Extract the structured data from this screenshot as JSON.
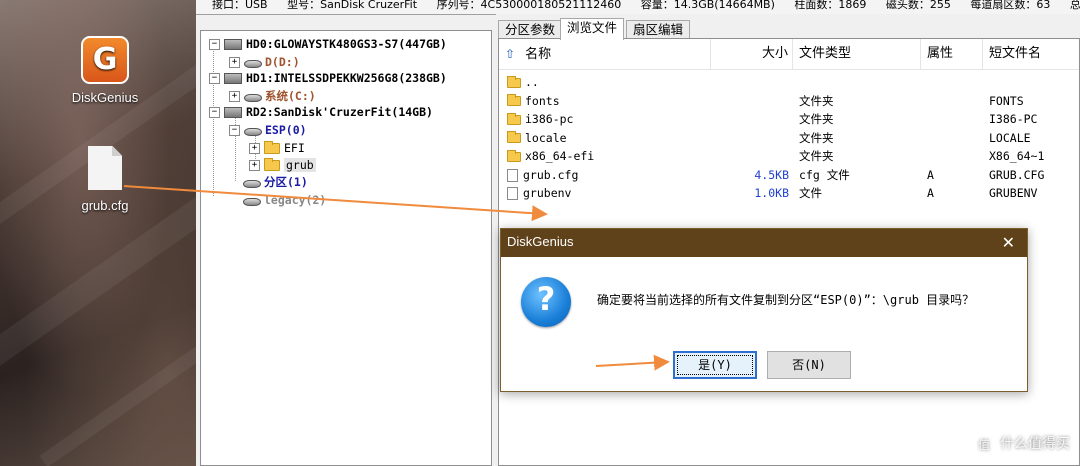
{
  "infobar": {
    "interface": "接口：USB",
    "model": "型号：SanDisk CruzerFit",
    "serial": "序列号：4C530000180521112460",
    "capacity": "容量：14.3GB(14664MB)",
    "cylinders": "柱面数：1869",
    "heads": "磁头数：255",
    "sectors": "每道扇区数：63",
    "total": "总扇区数："
  },
  "desktop": {
    "app_icon_label": "DiskGenius",
    "file_icon_label": "grub.cfg"
  },
  "tree": {
    "hd0": "HD0:GLOWAYSTK480GS3-S7(447GB)",
    "hd0_part": "D(D:)",
    "hd1": "HD1:INTELSSDPEKKW256G8(238GB)",
    "hd1_part": "系统(C:)",
    "rd2": "RD2:SanDisk'CruzerFit(14GB)",
    "esp": "ESP(0)",
    "efi": "EFI",
    "grub": "grub",
    "part1": "分区(1)",
    "legacy": "legacy(2)",
    "colors": {
      "hd0_part": "#a0522d",
      "esp": "#1a1aa6",
      "part1": "#1a1aa6"
    }
  },
  "tabs": [
    "分区参数",
    "浏览文件",
    "扇区编辑"
  ],
  "active_tab": 1,
  "filelist": {
    "columns": [
      "名称",
      "大小",
      "文件类型",
      "属性",
      "短文件名"
    ],
    "rows": [
      {
        "name": "..",
        "size": "",
        "type": "",
        "attr": "",
        "short": "",
        "icon": "folder-icon"
      },
      {
        "name": "fonts",
        "size": "",
        "type": "文件夹",
        "attr": "",
        "short": "FONTS",
        "icon": "folder-icon"
      },
      {
        "name": "i386-pc",
        "size": "",
        "type": "文件夹",
        "attr": "",
        "short": "I386-PC",
        "icon": "folder-icon"
      },
      {
        "name": "locale",
        "size": "",
        "type": "文件夹",
        "attr": "",
        "short": "LOCALE",
        "icon": "folder-icon"
      },
      {
        "name": "x86_64-efi",
        "size": "",
        "type": "文件夹",
        "attr": "",
        "short": "X86_64~1",
        "icon": "folder-icon"
      },
      {
        "name": "grub.cfg",
        "size": "4.5KB",
        "type": "cfg 文件",
        "attr": "A",
        "short": "GRUB.CFG",
        "icon": "document-icon"
      },
      {
        "name": "grubenv",
        "size": "1.0KB",
        "type": "文件",
        "attr": "A",
        "short": "GRUBENV",
        "icon": "document-icon"
      }
    ]
  },
  "dialog": {
    "title": "DiskGenius",
    "close_glyph": "✕",
    "message": "确定要将当前选择的所有文件复制到分区“ESP(0)”：\\grub 目录吗？",
    "yes_label": "是(Y)",
    "no_label": "否(N)",
    "icon": "question-icon"
  },
  "watermark": {
    "text": "什么值得买",
    "glyph": "值"
  },
  "colors": {
    "arrow": "#f08a3c",
    "dialog_title": "#5f421a",
    "accent": "#2f6fd0"
  }
}
